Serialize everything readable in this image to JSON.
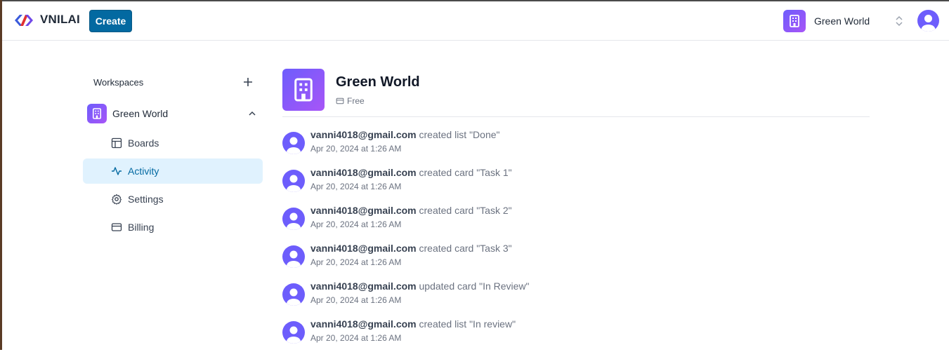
{
  "header": {
    "brand": "VNILAI",
    "create_label": "Create",
    "workspace_name": "Green World"
  },
  "sidebar": {
    "title": "Workspaces",
    "workspace": "Green World",
    "items": [
      {
        "label": "Boards",
        "icon": "layout-icon"
      },
      {
        "label": "Activity",
        "icon": "activity-icon",
        "active": true
      },
      {
        "label": "Settings",
        "icon": "gear-icon"
      },
      {
        "label": "Billing",
        "icon": "credit-card-icon"
      }
    ]
  },
  "main": {
    "title": "Green World",
    "plan": "Free",
    "activities": [
      {
        "user": "vanni4018@gmail.com",
        "action": "created list \"Done\"",
        "time": "Apr 20, 2024 at 1:26 AM"
      },
      {
        "user": "vanni4018@gmail.com",
        "action": "created card \"Task 1\"",
        "time": "Apr 20, 2024 at 1:26 AM"
      },
      {
        "user": "vanni4018@gmail.com",
        "action": "created card \"Task 2\"",
        "time": "Apr 20, 2024 at 1:26 AM"
      },
      {
        "user": "vanni4018@gmail.com",
        "action": "created card \"Task 3\"",
        "time": "Apr 20, 2024 at 1:26 AM"
      },
      {
        "user": "vanni4018@gmail.com",
        "action": "updated card \"In Review\"",
        "time": "Apr 20, 2024 at 1:26 AM"
      },
      {
        "user": "vanni4018@gmail.com",
        "action": "created list \"In review\"",
        "time": "Apr 20, 2024 at 1:26 AM"
      }
    ]
  },
  "colors": {
    "accent": "#0369a1",
    "active_bg": "#e0f2fe",
    "workspace_gradient_start": "#6d5dfc",
    "workspace_gradient_end": "#a855f7"
  }
}
